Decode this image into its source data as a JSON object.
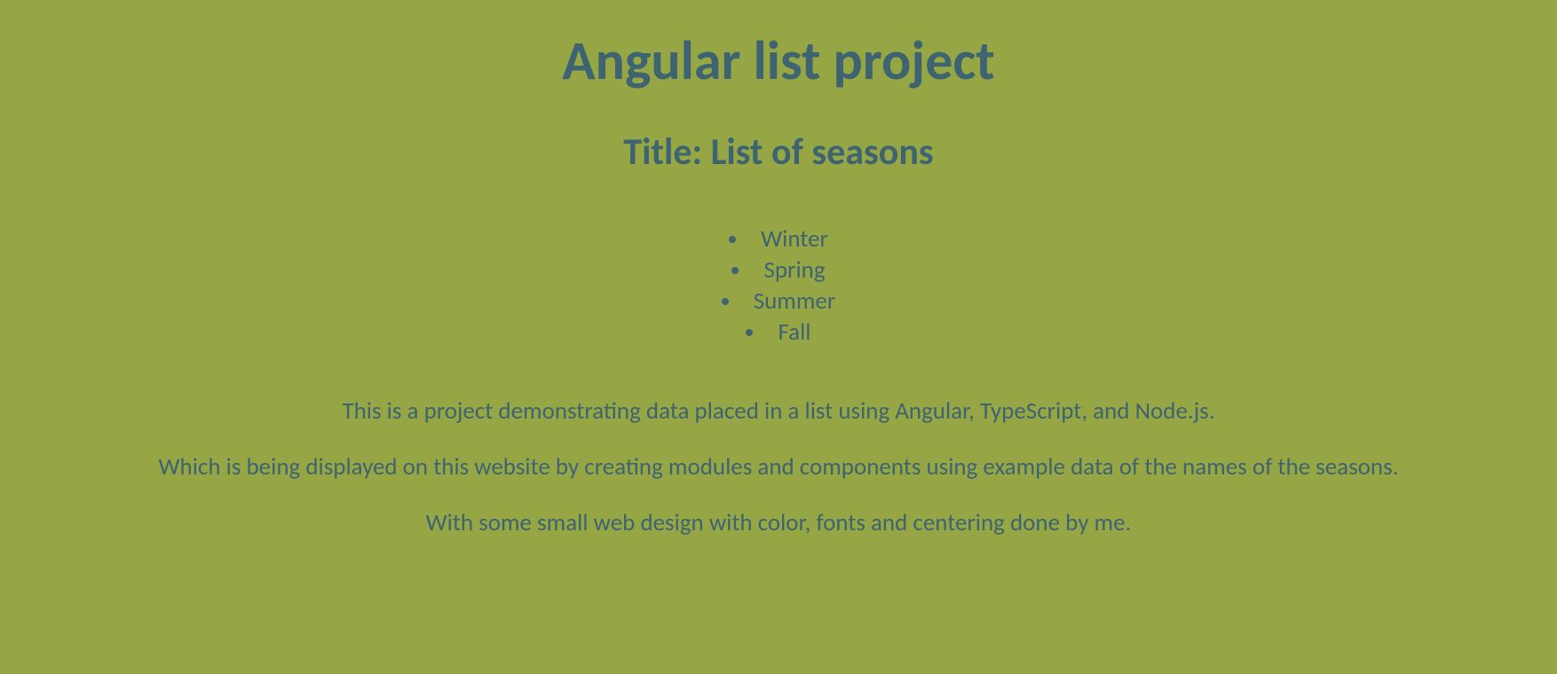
{
  "heading": "Angular list project",
  "subheading": "Title: List of seasons",
  "list_items": [
    "Winter",
    "Spring",
    "Summer",
    "Fall"
  ],
  "paragraphs": [
    "This is a project demonstrating data placed in a list using Angular, TypeScript, and Node.js.",
    "Which is being displayed on this website by creating modules and components using example data of the names of the seasons.",
    "With some small web design with color, fonts and centering done by me."
  ]
}
